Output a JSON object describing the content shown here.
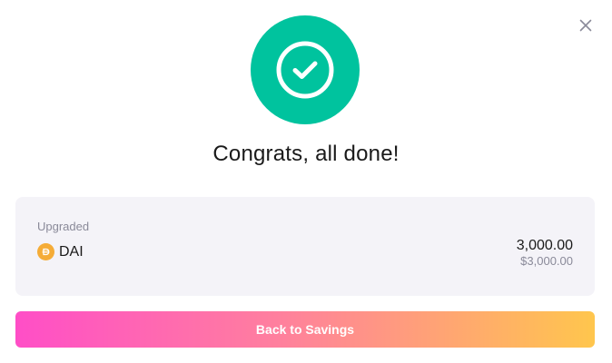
{
  "dialog": {
    "title": "Congrats, all done!",
    "close_icon": "close-icon",
    "success_icon": "check-circle-icon"
  },
  "summary": {
    "label": "Upgraded",
    "asset": {
      "icon": "dai-token-icon",
      "name": "DAI"
    },
    "amount": "3,000.00",
    "amount_usd": "$3,000.00"
  },
  "actions": {
    "back_label": "Back to Savings"
  },
  "colors": {
    "success": "#00c39e",
    "dai_token": "#f5ac37",
    "gradient_start": "#ff4ec7",
    "gradient_end": "#ffc64d",
    "card_bg": "#f4f3f8",
    "muted_text": "#8a8a99"
  }
}
